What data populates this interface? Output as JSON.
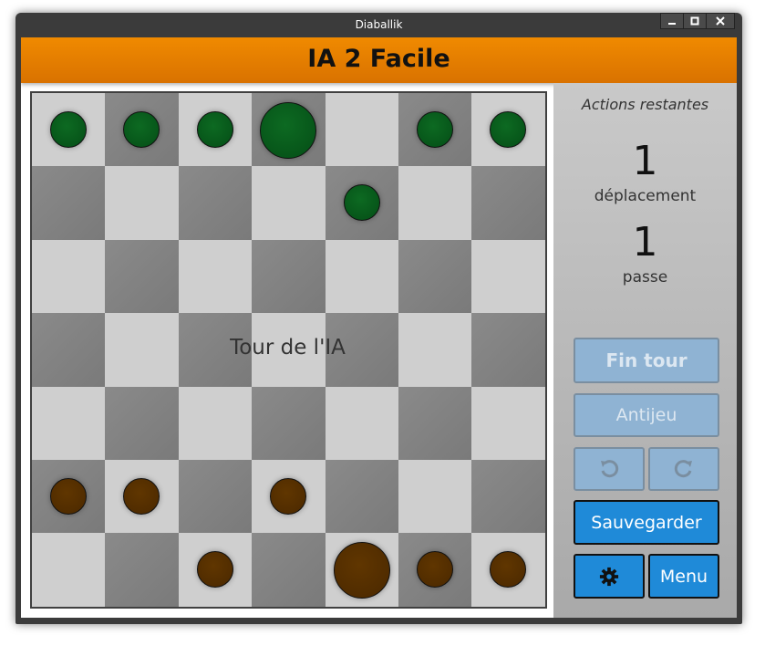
{
  "window": {
    "title": "Diaballik"
  },
  "header": {
    "title": "IA 2 Facile"
  },
  "board": {
    "rows": 7,
    "cols": 7,
    "turn_text": "Tour de l'IA",
    "pieces": [
      {
        "row": 0,
        "col": 0,
        "color": "green",
        "ball": false
      },
      {
        "row": 0,
        "col": 1,
        "color": "green",
        "ball": false
      },
      {
        "row": 0,
        "col": 2,
        "color": "green",
        "ball": false
      },
      {
        "row": 0,
        "col": 3,
        "color": "green",
        "ball": true
      },
      {
        "row": 0,
        "col": 5,
        "color": "green",
        "ball": false
      },
      {
        "row": 0,
        "col": 6,
        "color": "green",
        "ball": false
      },
      {
        "row": 1,
        "col": 4,
        "color": "green",
        "ball": false
      },
      {
        "row": 5,
        "col": 0,
        "color": "brown",
        "ball": false
      },
      {
        "row": 5,
        "col": 1,
        "color": "brown",
        "ball": false
      },
      {
        "row": 5,
        "col": 3,
        "color": "brown",
        "ball": false
      },
      {
        "row": 6,
        "col": 2,
        "color": "brown",
        "ball": false
      },
      {
        "row": 6,
        "col": 4,
        "color": "brown",
        "ball": true
      },
      {
        "row": 6,
        "col": 5,
        "color": "brown",
        "ball": false
      },
      {
        "row": 6,
        "col": 6,
        "color": "brown",
        "ball": false
      }
    ]
  },
  "side": {
    "actions_title": "Actions restantes",
    "moves_count": "1",
    "moves_label": "déplacement",
    "passes_count": "1",
    "passes_label": "passe",
    "end_turn_label": "Fin tour",
    "antigame_label": "Antijeu",
    "undo_icon": "undo-icon",
    "redo_icon": "redo-icon",
    "save_label": "Sauvegarder",
    "settings_icon": "gear-icon",
    "menu_label": "Menu"
  },
  "colors": {
    "header": "#e67e00",
    "green_piece": "#0a5a1c",
    "brown_piece": "#552f00",
    "button_active": "#1f8ad8",
    "button_disabled": "#8fb3d3"
  }
}
